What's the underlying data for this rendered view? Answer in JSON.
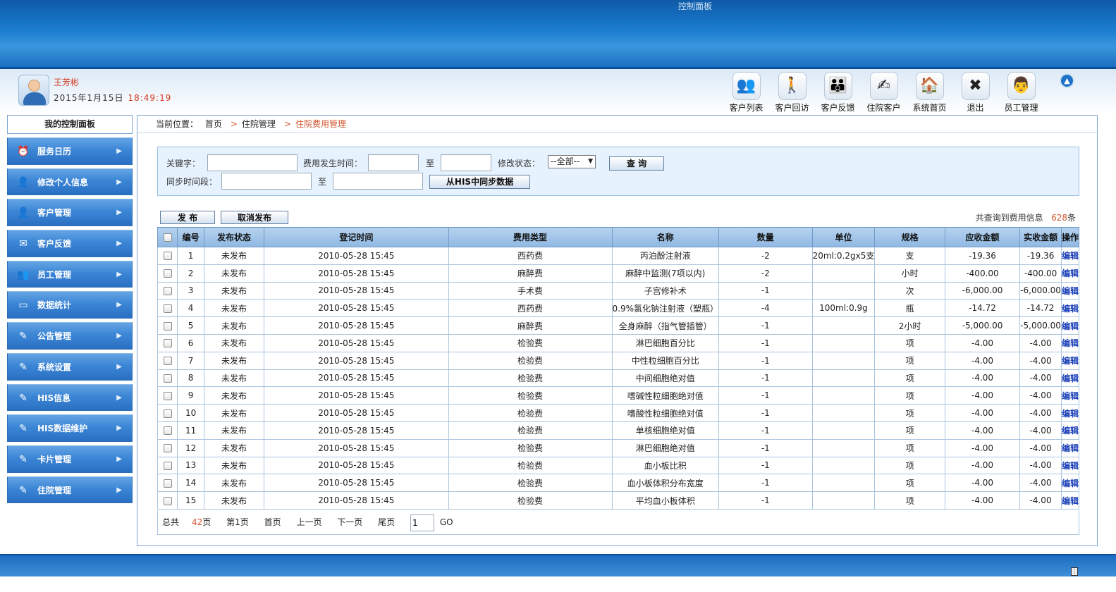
{
  "header": {
    "title": "控制面板"
  },
  "user": {
    "name": "王芳彬",
    "date": "2015年1月15日",
    "time": "18:49:19"
  },
  "toolbar": [
    {
      "label": "客户列表",
      "icon": "users-icon",
      "glyph": "👥"
    },
    {
      "label": "客户回访",
      "icon": "visit-icon",
      "glyph": "🚶"
    },
    {
      "label": "客户反馈",
      "icon": "feedback-icon",
      "glyph": "👪"
    },
    {
      "label": "住院客户",
      "icon": "inpatient-icon",
      "glyph": "✍"
    },
    {
      "label": "系统首页",
      "icon": "home-icon",
      "glyph": "🏠"
    },
    {
      "label": "退出",
      "icon": "exit-icon",
      "glyph": "✖"
    },
    {
      "label": "员工管理",
      "icon": "staff-icon",
      "glyph": "👨"
    }
  ],
  "sidebar": {
    "title": "我的控制面板",
    "items": [
      {
        "label": "服务日历",
        "icon": "clock-icon",
        "glyph": "⏰"
      },
      {
        "label": "修改个人信息",
        "icon": "person-icon",
        "glyph": "👤"
      },
      {
        "label": "客户管理",
        "icon": "customer-icon",
        "glyph": "👤"
      },
      {
        "label": "客户反馈",
        "icon": "feedback-icon",
        "glyph": "✉"
      },
      {
        "label": "员工管理",
        "icon": "staff-icon",
        "glyph": "👥"
      },
      {
        "label": "数据统计",
        "icon": "monitor-icon",
        "glyph": "▭"
      },
      {
        "label": "公告管理",
        "icon": "folder-icon",
        "glyph": "✎"
      },
      {
        "label": "系统设置",
        "icon": "folder-icon",
        "glyph": "✎"
      },
      {
        "label": "HIS信息",
        "icon": "folder-icon",
        "glyph": "✎"
      },
      {
        "label": "HIS数据维护",
        "icon": "folder-icon",
        "glyph": "✎"
      },
      {
        "label": "卡片管理",
        "icon": "folder-icon",
        "glyph": "✎"
      },
      {
        "label": "住院管理",
        "icon": "folder-icon",
        "glyph": "✎"
      }
    ]
  },
  "breadcrumb": {
    "prefix": "当前位置：",
    "home": "首页",
    "level1": "住院管理",
    "current": "住院费用管理"
  },
  "search": {
    "keyword_label": "关键字：",
    "time_label": "费用发生时间：",
    "to1": "至",
    "status_label": "修改状态：",
    "status_value": "--全部--",
    "query_button": "查 询",
    "sync_label": "同步时间段：",
    "to2": "至",
    "sync_button": "从HIS中同步数据"
  },
  "actions": {
    "publish": "发 布",
    "unpublish": "取消发布"
  },
  "count": {
    "prefix": "共查询到费用信息",
    "n": "628",
    "suffix": "条"
  },
  "table": {
    "headers": [
      "编号",
      "发布状态",
      "登记时间",
      "费用类型",
      "名称",
      "数量",
      "单位",
      "规格",
      "应收金额",
      "实收金额",
      "操作"
    ],
    "rows": [
      [
        "1",
        "未发布",
        "2010-05-28 15:45",
        "西药费",
        "丙泊酚注射液",
        "-2",
        "20ml:0.2gx5支",
        "支",
        "-19.36",
        "-19.36",
        "编辑"
      ],
      [
        "2",
        "未发布",
        "2010-05-28 15:45",
        "麻醉费",
        "麻醉中监测(7项以内)",
        "-2",
        "",
        "小时",
        "-400.00",
        "-400.00",
        "编辑"
      ],
      [
        "3",
        "未发布",
        "2010-05-28 15:45",
        "手术费",
        "子宫修补术",
        "-1",
        "",
        "次",
        "-6,000.00",
        "-6,000.00",
        "编辑"
      ],
      [
        "4",
        "未发布",
        "2010-05-28 15:45",
        "西药费",
        "0.9%氯化钠注射液（塑瓶）",
        "-4",
        "100ml:0.9g",
        "瓶",
        "-14.72",
        "-14.72",
        "编辑"
      ],
      [
        "5",
        "未发布",
        "2010-05-28 15:45",
        "麻醉费",
        "全身麻醉（指气管插管）",
        "-1",
        "",
        "2小时",
        "-5,000.00",
        "-5,000.00",
        "编辑"
      ],
      [
        "6",
        "未发布",
        "2010-05-28 15:45",
        "检验费",
        "淋巴细胞百分比",
        "-1",
        "",
        "项",
        "-4.00",
        "-4.00",
        "编辑"
      ],
      [
        "7",
        "未发布",
        "2010-05-28 15:45",
        "检验费",
        "中性粒细胞百分比",
        "-1",
        "",
        "项",
        "-4.00",
        "-4.00",
        "编辑"
      ],
      [
        "8",
        "未发布",
        "2010-05-28 15:45",
        "检验费",
        "中间细胞绝对值",
        "-1",
        "",
        "项",
        "-4.00",
        "-4.00",
        "编辑"
      ],
      [
        "9",
        "未发布",
        "2010-05-28 15:45",
        "检验费",
        "嗜碱性粒细胞绝对值",
        "-1",
        "",
        "项",
        "-4.00",
        "-4.00",
        "编辑"
      ],
      [
        "10",
        "未发布",
        "2010-05-28 15:45",
        "检验费",
        "嗜酸性粒细胞绝对值",
        "-1",
        "",
        "项",
        "-4.00",
        "-4.00",
        "编辑"
      ],
      [
        "11",
        "未发布",
        "2010-05-28 15:45",
        "检验费",
        "单核细胞绝对值",
        "-1",
        "",
        "项",
        "-4.00",
        "-4.00",
        "编辑"
      ],
      [
        "12",
        "未发布",
        "2010-05-28 15:45",
        "检验费",
        "淋巴细胞绝对值",
        "-1",
        "",
        "项",
        "-4.00",
        "-4.00",
        "编辑"
      ],
      [
        "13",
        "未发布",
        "2010-05-28 15:45",
        "检验费",
        "血小板比积",
        "-1",
        "",
        "项",
        "-4.00",
        "-4.00",
        "编辑"
      ],
      [
        "14",
        "未发布",
        "2010-05-28 15:45",
        "检验费",
        "血小板体积分布宽度",
        "-1",
        "",
        "项",
        "-4.00",
        "-4.00",
        "编辑"
      ],
      [
        "15",
        "未发布",
        "2010-05-28 15:45",
        "检验费",
        "平均血小板体积",
        "-1",
        "",
        "项",
        "-4.00",
        "-4.00",
        "编辑"
      ]
    ]
  },
  "pager": {
    "total_prefix": "总共",
    "total_pages": "42",
    "total_suffix": "页",
    "current": "第1页",
    "first": "首页",
    "prev": "上一页",
    "next": "下一页",
    "last": "尾页",
    "page_input": "1",
    "go": "GO"
  },
  "colors": {
    "accent": "#2a6fc2",
    "highlight": "#d2542e"
  }
}
